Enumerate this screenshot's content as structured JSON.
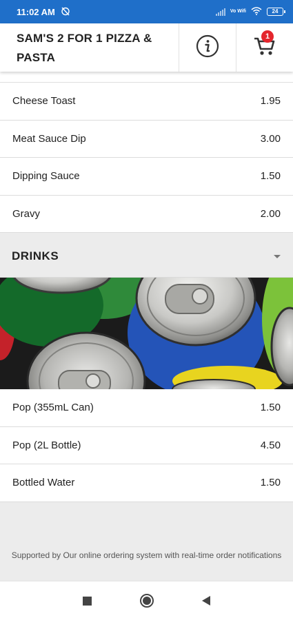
{
  "status_bar": {
    "time": "11:02 AM",
    "network_label": "Vo Wifi",
    "battery": "24"
  },
  "header": {
    "title": "SAM'S 2 FOR 1 PIZZA & PASTA",
    "info_icon": "info-icon",
    "cart_icon": "cart-icon",
    "cart_count": "1"
  },
  "colors": {
    "status_bar": "#1f6fc9",
    "badge": "#e4262d"
  },
  "menu_items": [
    {
      "name": "Cheese Toast",
      "price": "1.95"
    },
    {
      "name": "Meat Sauce Dip",
      "price": "3.00"
    },
    {
      "name": "Dipping Sauce",
      "price": "1.50"
    },
    {
      "name": "Gravy",
      "price": "2.00"
    }
  ],
  "drinks_section": {
    "title": "DRINKS",
    "items": [
      {
        "name": "Pop (355mL Can)",
        "price": "1.50"
      },
      {
        "name": "Pop (2L Bottle)",
        "price": "4.50"
      },
      {
        "name": "Bottled Water",
        "price": "1.50"
      }
    ]
  },
  "footer": {
    "text": "Supported by Our online ordering system with real-time order notifications"
  }
}
